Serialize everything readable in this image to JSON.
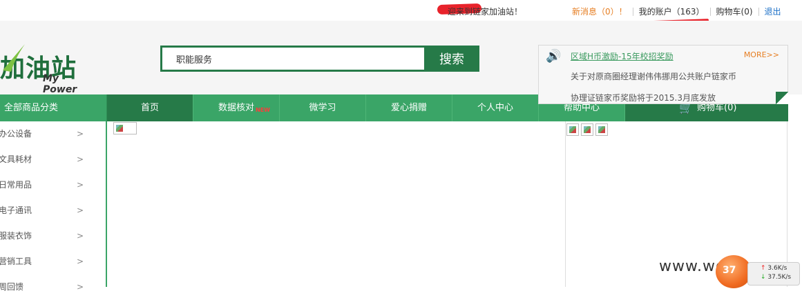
{
  "topbar": {
    "welcome": "迎来到链家加油站！",
    "new_msg": "新消息（0）！",
    "account": "我的账户（163）",
    "cart": "购物车(0)",
    "logout": "退出"
  },
  "logo": {
    "text": "加油站",
    "tagline": "My Power"
  },
  "search": {
    "value": "职能服务",
    "button": "搜索"
  },
  "nav": {
    "all_categories": "全部商品分类",
    "items": [
      {
        "label": "首页"
      },
      {
        "label": "数据核对",
        "badge": "NEW"
      },
      {
        "label": "微学习"
      },
      {
        "label": "爱心捐赠"
      },
      {
        "label": "个人中心"
      },
      {
        "label": "帮助中心"
      }
    ],
    "cart": "购物车(0)"
  },
  "sidebar": {
    "items": [
      {
        "label": "办公设备"
      },
      {
        "label": "文具耗材"
      },
      {
        "label": "日常用品"
      },
      {
        "label": "电子通讯"
      },
      {
        "label": "服装衣饰"
      },
      {
        "label": "营销工具"
      },
      {
        "label": "周回馈"
      }
    ],
    "arrow": ">"
  },
  "notice": {
    "headline": "区域H币激励-15年校招奖励",
    "more": "MORE>>",
    "line1": "关于对原商圈经理谢伟伟挪用公共账户链家币",
    "line2": "协理证链家币奖励将于2015.3月底发放"
  },
  "watermark": "www.wooyun.org",
  "netmeter": {
    "percent": "37",
    "up": "3.6K/s",
    "down": "37.5K/s"
  },
  "colors": {
    "brand_green": "#3aa567",
    "dark_green": "#267a48",
    "link_orange": "#e67e22",
    "logout_blue": "#1a6fc7"
  }
}
